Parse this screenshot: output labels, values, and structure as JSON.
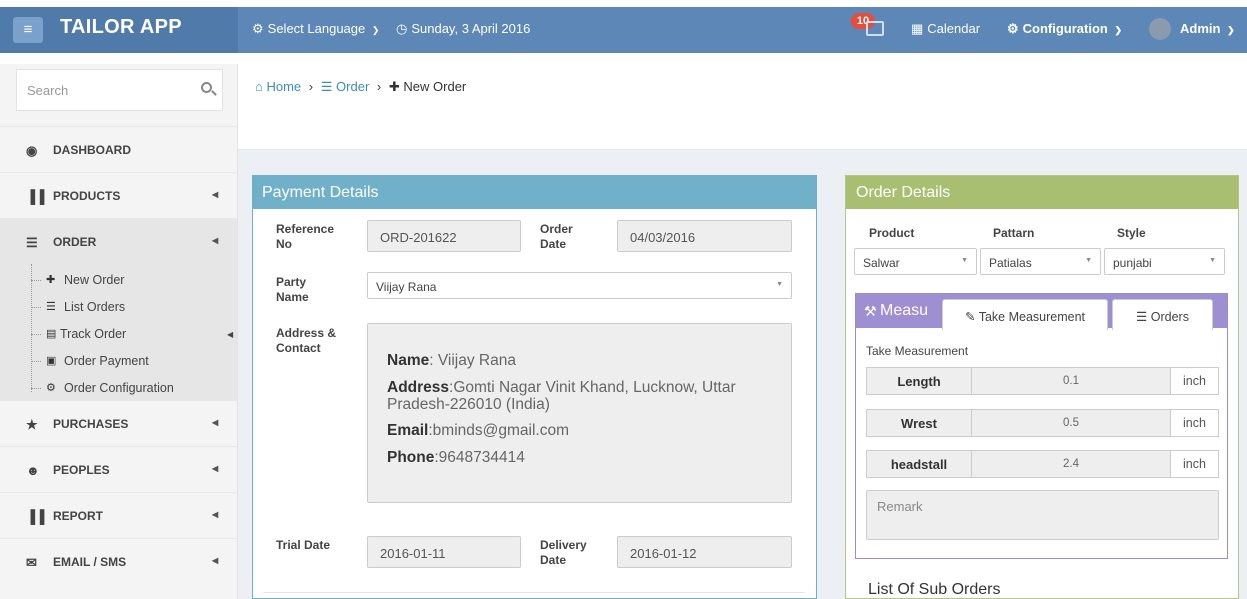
{
  "app": {
    "title": "TAILOR APP"
  },
  "topbar": {
    "language": "Select Language",
    "date": "Sunday, 3 April 2016",
    "notifications_count": "10",
    "calendar": "Calendar",
    "configuration": "Configuration",
    "user": "Admin"
  },
  "sidebar": {
    "search_placeholder": "Search",
    "items": [
      {
        "label": "DASHBOARD",
        "icon": "dashboard-icon"
      },
      {
        "label": "PRODUCTS",
        "icon": "barcode-icon"
      },
      {
        "label": "ORDER",
        "icon": "list-icon"
      },
      {
        "label": "PURCHASES",
        "icon": "star-icon"
      },
      {
        "label": "PEOPLES",
        "icon": "users-icon"
      },
      {
        "label": "REPORT",
        "icon": "barcode-icon"
      },
      {
        "label": "EMAIL / SMS",
        "icon": "envelope-icon"
      }
    ],
    "order_submenu": [
      {
        "label": "New Order",
        "icon": "plus-icon"
      },
      {
        "label": "List Orders",
        "icon": "list-icon"
      },
      {
        "label": "Track Order",
        "icon": "list-alt-icon"
      },
      {
        "label": "Order Payment",
        "icon": "money-icon"
      },
      {
        "label": "Order Configuration",
        "icon": "gear-icon"
      }
    ]
  },
  "breadcrumb": {
    "home": "Home",
    "order": "Order",
    "current": "New Order"
  },
  "payment": {
    "title": "Payment Details",
    "reference_label": "Reference No",
    "reference_value": "ORD-201622",
    "order_date_label": "Order Date",
    "order_date_value": "04/03/2016",
    "party_label": "Party Name",
    "party_value": "Viijay Rana",
    "address_label": "Address & Contact",
    "contact": {
      "name_key": "Name",
      "name": ": Viijay Rana",
      "address_key": "Address",
      "address_line1": ":Gomti Nagar Vinit Khand, Lucknow, Uttar",
      "address_line2": "Pradesh-226010 (India)",
      "email_key": "Email",
      "email": ":bminds@gmail.com",
      "phone_key": "Phone",
      "phone": ":9648734414"
    },
    "trial_label": "Trial Date",
    "trial_value": "2016-01-11",
    "delivery_label": "Delivery Date",
    "delivery_value": "2016-01-12"
  },
  "order": {
    "title": "Order Details",
    "product_label": "Product",
    "product_value": "Salwar",
    "pattern_label": "Pattarn",
    "pattern_value": "Patialas",
    "style_label": "Style",
    "style_value": "punjabi",
    "measurement": {
      "title": "Measu",
      "tab_take": "Take Measurement",
      "tab_orders": "Orders",
      "caption": "Take Measurement",
      "rows": [
        {
          "name": "Length",
          "value": "0.1",
          "unit": "inch"
        },
        {
          "name": "Wrest",
          "value": "0.5",
          "unit": "inch"
        },
        {
          "name": "headstall",
          "value": "2.4",
          "unit": "inch"
        }
      ],
      "remark_placeholder": "Remark"
    },
    "sub_orders_title": "List Of Sub Orders"
  }
}
